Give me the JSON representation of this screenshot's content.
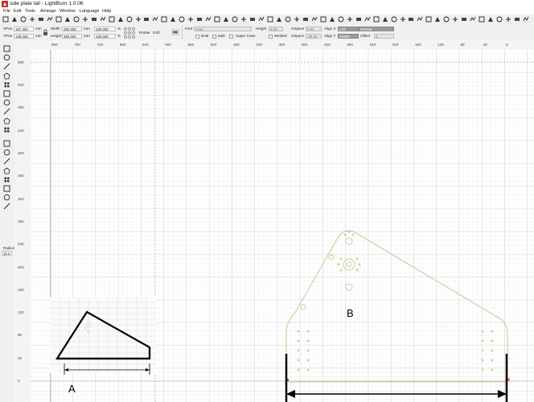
{
  "window": {
    "title": "side plate tall - LightBurn 1.0.06"
  },
  "menu": [
    "File",
    "Edit",
    "Tools",
    "Arrange",
    "Window",
    "Language",
    "Help"
  ],
  "toolbar_icons": [
    "new-file-icon",
    "open-file-icon",
    "save-icon",
    "save-as-icon",
    "print-icon",
    "undo-icon",
    "redo-icon",
    "delete-icon",
    "copy-icon",
    "cut-icon",
    "paste-icon",
    "import-icon",
    "move-icon",
    "zoom-in-icon",
    "zoom-out-icon",
    "zoom-to-frame-icon",
    "zoom-selection-icon",
    "camera-icon",
    "gear-icon",
    "wrench-icon",
    "group-icon",
    "ungroup-icon",
    "align-left-icon",
    "align-center-icon",
    "align-right-icon",
    "align-top-icon",
    "align-middle-icon",
    "align-bottom-icon",
    "distribute-h-icon",
    "distribute-v-icon",
    "dock-left-icon",
    "dock-right-icon",
    "dock-top-icon",
    "dock-bottom-icon",
    "arrange-icon",
    "flip-h-icon",
    "flip-v-icon",
    "rotate-icon",
    "mirror-icon",
    "weld-icon",
    "boolean-union-icon",
    "boolean-subtract-icon",
    "boolean-intersect-icon",
    "array-icon",
    "grid-array-icon",
    "circular-array-icon",
    "offset-icon",
    "node-edit-icon",
    "trim-icon",
    "tab-icon",
    "measure-icon",
    "preview-icon",
    "frame-icon",
    "bounding-box-icon",
    "start-from-icon",
    "machine-icon",
    "laser-icon",
    "console-icon",
    "align-x-icon",
    "align-y-icon"
  ],
  "props": {
    "xpos_label": "XPos",
    "xpos_value": "187.384",
    "ypos_label": "YPos",
    "ypos_value": "136.063",
    "unit_mm": "mm",
    "width_label": "Width",
    "width_value": "382.000",
    "height_label": "Height",
    "height_value": "384.000",
    "scale_w": "100.000",
    "scale_h": "100.000",
    "pct": "%",
    "rotate_label": "Rotate",
    "rotate_value": "0.00",
    "font_label": "Font",
    "font_value": "Arial",
    "fheight_label": "Height",
    "fheight_value": "5.48",
    "hspace_label": "HSpace",
    "hspace_value": "0.00",
    "vspace_label": "VSpace",
    "vspace_value": "-25.00",
    "alignx_label": "Align X",
    "alignx_value": "Left",
    "aligny_label": "Align Y",
    "aligny_value": "Middle",
    "style_value": "Normal",
    "offset_label": "Offset",
    "offset_value": "0",
    "bold_label": "Bold",
    "italic_label": "Italic",
    "upper_label": "Upper Case",
    "welded_label": "Welded"
  },
  "left_tools": [
    "select-icon",
    "edit-nodes-icon",
    "rectangle-icon",
    "ellipse-icon",
    "polygon-icon",
    "line-icon",
    "rounded-rect-icon",
    "text-icon",
    "position-laser-icon",
    "measure-icon",
    "trace-icon",
    "offset-icon",
    "weld-icon",
    "boolean-icon",
    "array-icon",
    "grid-icon",
    "circular-array-icon",
    "corner-icon"
  ],
  "radius": {
    "label": "Radius",
    "value": "10.0"
  },
  "ruler_x": [
    "800",
    "760",
    "720",
    "680",
    "640",
    "600",
    "560",
    "520",
    "480",
    "440",
    "400",
    "360",
    "320",
    "280",
    "240",
    "200",
    "160",
    "120",
    "80",
    "40",
    "0"
  ],
  "ruler_y": [
    "560",
    "520",
    "480",
    "440",
    "400",
    "360",
    "320",
    "280",
    "240",
    "200",
    "160",
    "120",
    "80",
    "40",
    "0"
  ],
  "annotations": {
    "a": "A",
    "b": "B"
  }
}
